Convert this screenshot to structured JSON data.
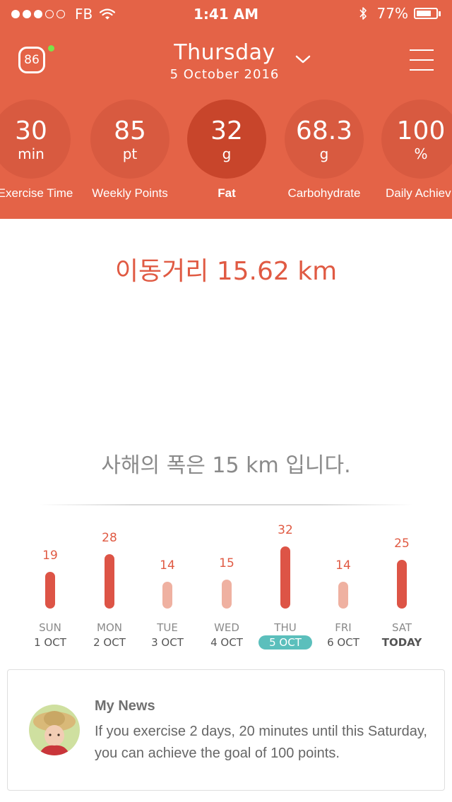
{
  "status_bar": {
    "carrier": "FB",
    "time": "1:41 AM",
    "battery_percent": "77%",
    "battery_level": 0.77,
    "signal_bars_filled": 3,
    "signal_bars_total": 5
  },
  "header": {
    "score": "86",
    "day": "Thursday",
    "date": "5 October 2016",
    "chevron_icon": "chevron-down-icon",
    "menu_icon": "hamburger-menu-icon"
  },
  "metrics": [
    {
      "value": "30",
      "unit": "min",
      "label": "Exercise Time",
      "active": false
    },
    {
      "value": "85",
      "unit": "pt",
      "label": "Weekly Points",
      "active": false
    },
    {
      "value": "32",
      "unit": "g",
      "label": "Fat",
      "active": true
    },
    {
      "value": "68.3",
      "unit": "g",
      "label": "Carbohydrate",
      "active": false
    },
    {
      "value": "100",
      "unit": "%",
      "label": "Daily Achiev",
      "active": false
    }
  ],
  "distance_text": "이동거리 15.62 km",
  "info_text": "사해의 폭은 15 km 입니다.",
  "week_chart": {
    "max_value": 32,
    "days": [
      {
        "day": "SUN",
        "date": "1 OCT",
        "value": 19,
        "highlight": true,
        "selected": false,
        "today": false
      },
      {
        "day": "MON",
        "date": "2 OCT",
        "value": 28,
        "highlight": true,
        "selected": false,
        "today": false
      },
      {
        "day": "TUE",
        "date": "3 OCT",
        "value": 14,
        "highlight": false,
        "selected": false,
        "today": false
      },
      {
        "day": "WED",
        "date": "4 OCT",
        "value": 15,
        "highlight": false,
        "selected": false,
        "today": false
      },
      {
        "day": "THU",
        "date": "5 OCT",
        "value": 32,
        "highlight": true,
        "selected": true,
        "today": false
      },
      {
        "day": "FRI",
        "date": "6 OCT",
        "value": 14,
        "highlight": false,
        "selected": false,
        "today": false
      },
      {
        "day": "SAT",
        "date": "TODAY",
        "value": 25,
        "highlight": true,
        "selected": false,
        "today": true
      }
    ]
  },
  "news": {
    "title": "My News",
    "body": "If you exercise 2 days, 20 minutes until this Saturday, you can achieve the goal of 100 points.",
    "avatar_icon": "avatar"
  },
  "colors": {
    "header_bg": "#e46347",
    "circle_bg": "#d85a40",
    "circle_active_bg": "#c8452b",
    "bar_strong": "#dd5446",
    "bar_light": "#efb1a1",
    "selected_date_bg": "#5bbfbc",
    "accent_text": "#e05a43"
  }
}
